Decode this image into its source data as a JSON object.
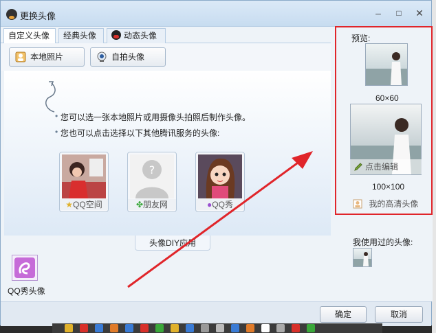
{
  "window": {
    "title": "更换头像",
    "minimize": "–",
    "maximize": "□",
    "close": "✕"
  },
  "tabs": [
    {
      "label": "自定义头像"
    },
    {
      "label": "经典头像"
    },
    {
      "label": "动态头像"
    }
  ],
  "toolbar": {
    "local_photo": "本地照片",
    "selfie": "自拍头像"
  },
  "hints": [
    "您可以选一张本地照片或用摄像头拍照后制作头像。",
    "您也可以点击选择以下其他腾讯服务的头像:"
  ],
  "services": [
    {
      "label": "QQ空间"
    },
    {
      "label": "朋友网"
    },
    {
      "label": "QQ秀"
    }
  ],
  "diy_tab": "头像DIY应用",
  "app_label": "QQ秀头像",
  "preview": {
    "label": "预览:",
    "size_small": "60×60",
    "size_large": "100×100",
    "edit": "点击编辑",
    "hd": "我的高清头像"
  },
  "used_label": "我使用过的头像:",
  "buttons": {
    "ok": "确定",
    "cancel": "取消"
  },
  "colors": {
    "highlight": "#e0252a",
    "arrow": "#e0252a"
  }
}
